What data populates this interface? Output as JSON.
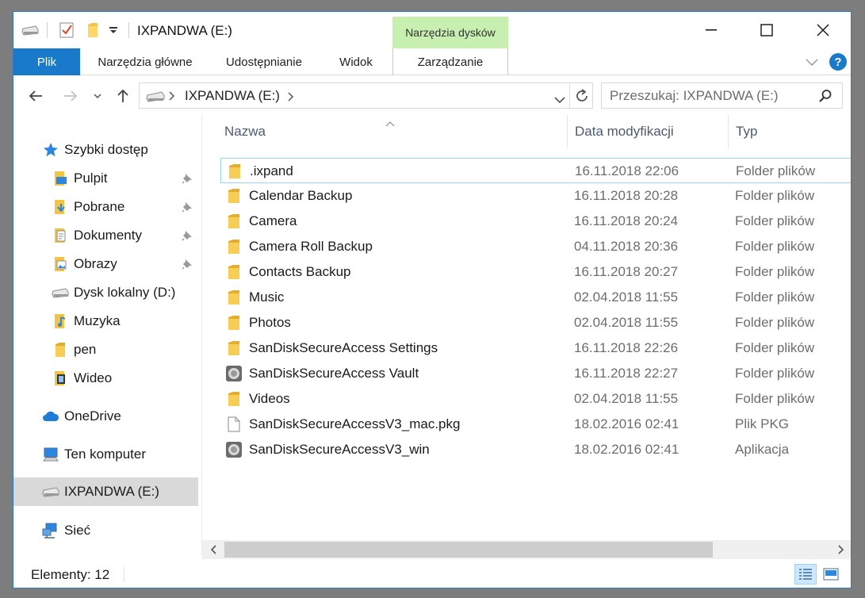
{
  "window": {
    "title": "IXPANDWA (E:)"
  },
  "ribbon": {
    "context_group": "Narzędzia dysków",
    "tabs": [
      {
        "label": "Plik"
      },
      {
        "label": "Narzędzia główne"
      },
      {
        "label": "Udostępnianie"
      },
      {
        "label": "Widok"
      },
      {
        "label": "Zarządzanie"
      }
    ]
  },
  "address": {
    "path": "IXPANDWA (E:)"
  },
  "search": {
    "placeholder": "Przeszukaj: IXPANDWA (E:)"
  },
  "sidebar": {
    "quick_access": "Szybki dostęp",
    "pinned": [
      {
        "label": "Pulpit",
        "icon": "desktop-folder-icon"
      },
      {
        "label": "Pobrane",
        "icon": "downloads-folder-icon"
      },
      {
        "label": "Dokumenty",
        "icon": "documents-folder-icon"
      },
      {
        "label": "Obrazy",
        "icon": "pictures-folder-icon"
      }
    ],
    "others": [
      {
        "label": "Dysk lokalny (D:)",
        "icon": "drive-icon"
      },
      {
        "label": "Muzyka",
        "icon": "music-folder-icon"
      },
      {
        "label": "pen",
        "icon": "folder-icon"
      },
      {
        "label": "Wideo",
        "icon": "video-folder-icon"
      }
    ],
    "roots": [
      {
        "label": "OneDrive",
        "icon": "onedrive-icon"
      },
      {
        "label": "Ten komputer",
        "icon": "computer-icon"
      },
      {
        "label": "IXPANDWA (E:)",
        "icon": "usb-drive-icon",
        "selected": true
      },
      {
        "label": "Sieć",
        "icon": "network-icon"
      }
    ]
  },
  "columns": {
    "name": "Nazwa",
    "date": "Data modyfikacji",
    "type": "Typ"
  },
  "files": [
    {
      "name": ".ixpand",
      "date": "16.11.2018 22:06",
      "type": "Folder plików",
      "icon": "folder-icon"
    },
    {
      "name": "Calendar Backup",
      "date": "16.11.2018 20:28",
      "type": "Folder plików",
      "icon": "folder-icon"
    },
    {
      "name": "Camera",
      "date": "16.11.2018 20:24",
      "type": "Folder plików",
      "icon": "folder-icon"
    },
    {
      "name": "Camera Roll Backup",
      "date": "04.11.2018 20:36",
      "type": "Folder plików",
      "icon": "folder-icon"
    },
    {
      "name": "Contacts Backup",
      "date": "16.11.2018 20:27",
      "type": "Folder plików",
      "icon": "folder-icon"
    },
    {
      "name": "Music",
      "date": "02.04.2018 11:55",
      "type": "Folder plików",
      "icon": "folder-icon"
    },
    {
      "name": "Photos",
      "date": "02.04.2018 11:55",
      "type": "Folder plików",
      "icon": "folder-icon"
    },
    {
      "name": "SanDiskSecureAccess Settings",
      "date": "16.11.2018 22:26",
      "type": "Folder plików",
      "icon": "folder-icon"
    },
    {
      "name": "SanDiskSecureAccess Vault",
      "date": "16.11.2018 22:27",
      "type": "Folder plików",
      "icon": "vault-folder-icon"
    },
    {
      "name": "Videos",
      "date": "02.04.2018 11:55",
      "type": "Folder plików",
      "icon": "folder-icon"
    },
    {
      "name": "SanDiskSecureAccessV3_mac.pkg",
      "date": "18.02.2016 02:41",
      "type": "Plik PKG",
      "icon": "file-icon"
    },
    {
      "name": "SanDiskSecureAccessV3_win",
      "date": "18.02.2016 02:41",
      "type": "Aplikacja",
      "icon": "application-icon"
    }
  ],
  "status": {
    "items": "Elementy: 12"
  },
  "colors": {
    "accent": "#1979ca",
    "context_tab": "#c6efb0",
    "selection": "#d9d9d9",
    "folder": "#f4c542"
  }
}
